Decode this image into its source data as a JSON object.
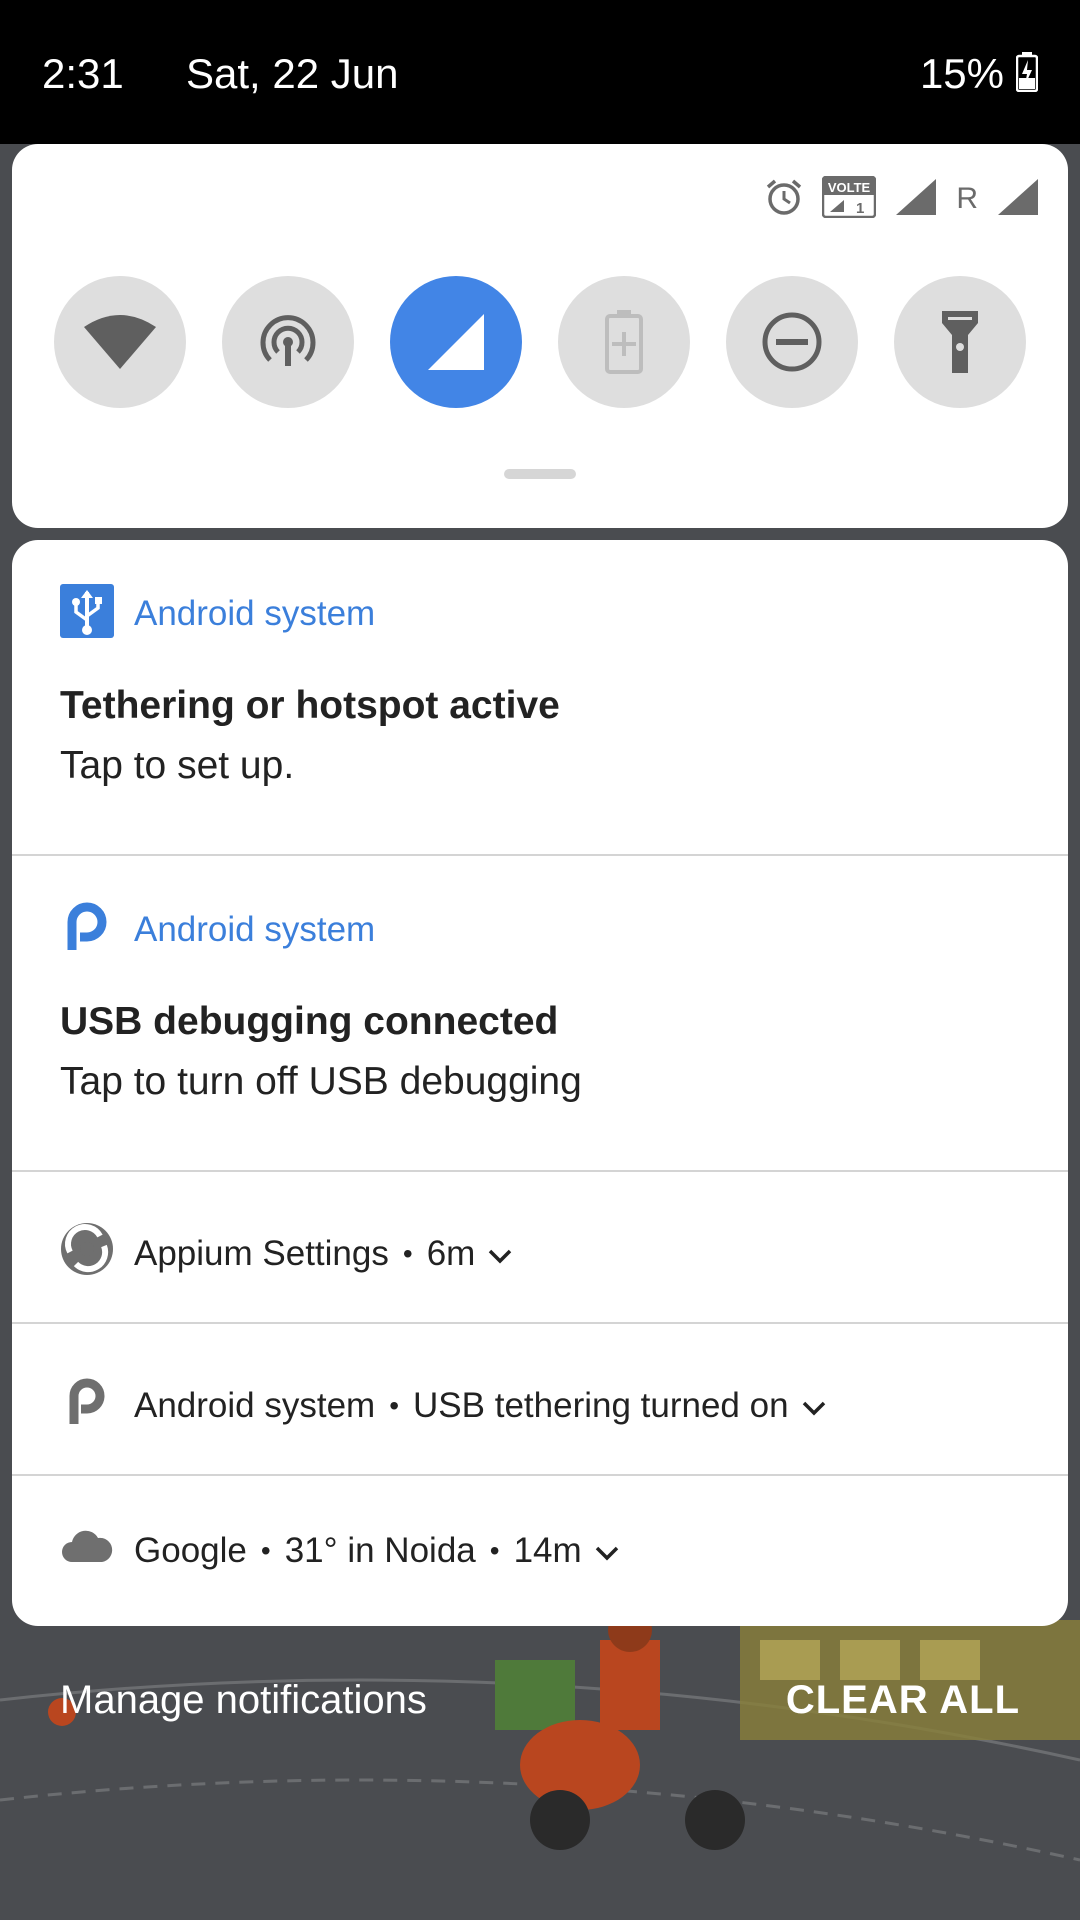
{
  "status_bar": {
    "time": "2:31",
    "date": "Sat, 22 Jun",
    "battery": "15%",
    "battery_icon": "battery-charging-icon"
  },
  "quick_settings": {
    "status_icons": [
      "alarm-icon",
      "volte-icon",
      "signal-icon",
      "roaming-icon",
      "signal-icon"
    ],
    "volte_label": "VOLTE",
    "volte_sim": "1",
    "roaming_label": "R",
    "tiles": [
      {
        "icon": "wifi-icon",
        "active": false
      },
      {
        "icon": "hotspot-icon",
        "active": false
      },
      {
        "icon": "mobile-data-icon",
        "active": true
      },
      {
        "icon": "battery-saver-icon",
        "active": false
      },
      {
        "icon": "do-not-disturb-icon",
        "active": false
      },
      {
        "icon": "flashlight-icon",
        "active": false
      }
    ],
    "accent_color": "#4285e6"
  },
  "notifications": [
    {
      "app": "Android system",
      "icon": "usb-icon",
      "title": "Tethering or hotspot active",
      "text": "Tap to set up."
    },
    {
      "app": "Android system",
      "icon": "android-p-icon",
      "title": "USB debugging connected",
      "text": "Tap to turn off USB debugging"
    },
    {
      "app": "Appium Settings",
      "icon": "appium-icon",
      "time": "6m"
    },
    {
      "app": "Android system",
      "icon": "android-p-icon",
      "text": "USB tethering turned on"
    },
    {
      "app": "Google",
      "icon": "cloud-icon",
      "text": "31° in Noida",
      "time": "14m"
    }
  ],
  "footer": {
    "manage": "Manage notifications",
    "clear_all": "CLEAR ALL"
  }
}
